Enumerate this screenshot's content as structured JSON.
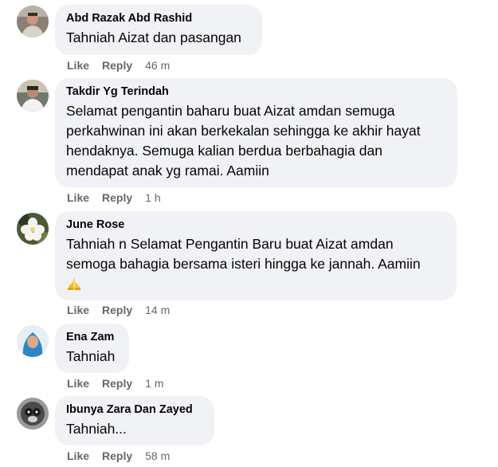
{
  "actions": {
    "like_label": "Like",
    "reply_label": "Reply"
  },
  "comments": [
    {
      "author": "Abd Razak Abd Rashid",
      "text": "Tahniah Aizat dan pasangan",
      "time": "46 m",
      "avatar_icon": "person-photo-icon"
    },
    {
      "author": "Takdir Yg Terindah",
      "text_lines": [
        "Selamat pengantin baharu buat Aizat amdan semuga",
        "perkahwinan ini akan berkekalan sehingga ke akhir hayat",
        "hendaknya. Semuga kalian berdua berbahagia dan",
        "mendapat anak yg ramai. Aamiin"
      ],
      "time": "1 h",
      "avatar_icon": "person-photo-icon"
    },
    {
      "author": "June Rose",
      "text_lines": [
        "Tahniah n Selamat Pengantin Baru buat Aizat amdan",
        "semoga bahagia bersama isteri hingga ke jannah. Aamiin"
      ],
      "emoji": "praying-hands-emoji",
      "time": "14 m",
      "avatar_icon": "flower-photo-icon"
    },
    {
      "author": "Ena Zam",
      "text": "Tahniah",
      "time": "1 m",
      "avatar_icon": "person-hijab-photo-icon"
    },
    {
      "author": "Ibunya Zara Dan Zayed",
      "text": "Tahniah...",
      "time": "58 m",
      "avatar_icon": "monochrome-photo-icon"
    }
  ],
  "colors": {
    "bubble": "#f0f2f5",
    "meta_text": "#65676b",
    "primary_text": "#050505"
  }
}
